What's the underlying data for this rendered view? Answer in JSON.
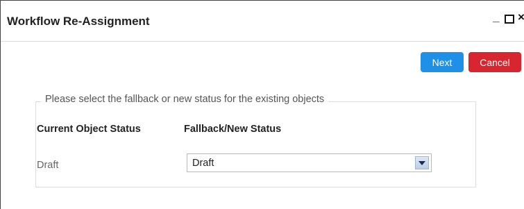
{
  "window": {
    "title": "Workflow Re-Assignment",
    "minimize_label": "_",
    "close_label": "×"
  },
  "actions": {
    "next_label": "Next",
    "cancel_label": "Cancel",
    "next_color": "#1e90e8",
    "cancel_color": "#d7262f"
  },
  "form": {
    "legend": "Please select the fallback or new status for the existing objects",
    "columns": [
      "Current Object Status",
      "Fallback/New Status"
    ],
    "rows": [
      {
        "current_status": "Draft",
        "fallback_value": "Draft"
      }
    ]
  }
}
